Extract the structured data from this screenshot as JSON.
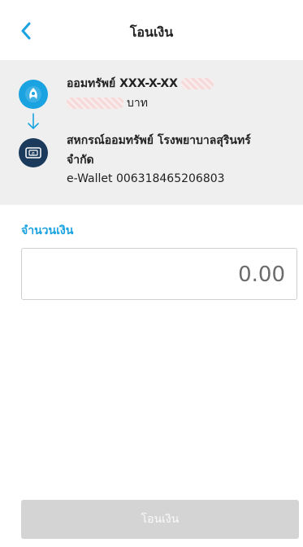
{
  "header": {
    "title": "โอนเงิน",
    "back_icon": "chevron-left-icon"
  },
  "transfer": {
    "from": {
      "icon": "kbank-logo-icon",
      "account_label": "ออมทรัพย์ XXX-X-XX",
      "balance_suffix": "บาท"
    },
    "to": {
      "icon": "wallet-icon",
      "name_line1": "สหกรณ์ออมทรัพย์ โรงพยาบาลสุรินทร์",
      "name_line2": "จำกัด",
      "wallet_id": "e-Wallet 006318465206803"
    }
  },
  "amount": {
    "label": "จำนวนเงิน",
    "placeholder": "0.00"
  },
  "submit": {
    "label": "โอนเงิน"
  },
  "colors": {
    "accent": "#1aa3e0",
    "panel_bg": "#efefef",
    "wallet_icon_bg": "#1b3a5c",
    "disabled_button": "#d4d4d4"
  }
}
